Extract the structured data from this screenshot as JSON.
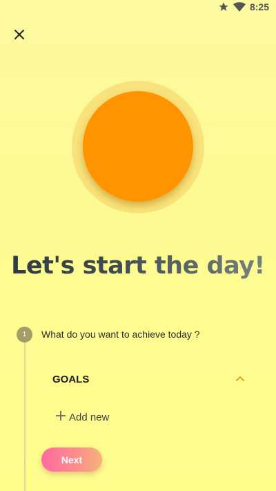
{
  "status_bar": {
    "time": "8:25",
    "icons": [
      "star-icon",
      "wifi-icon"
    ]
  },
  "header": {
    "close_icon": "close-icon"
  },
  "hero": {
    "icon": "sun-icon",
    "sun_color": "#ff9300"
  },
  "headline": "Let's start the day!",
  "step": {
    "number": "1",
    "question": "What do you want to achieve today ?"
  },
  "goals": {
    "title": "GOALS",
    "toggle_icon": "chevron-up-icon",
    "accent_color": "#f0a30a",
    "add_new_label": "Add new"
  },
  "next_label": "Next"
}
